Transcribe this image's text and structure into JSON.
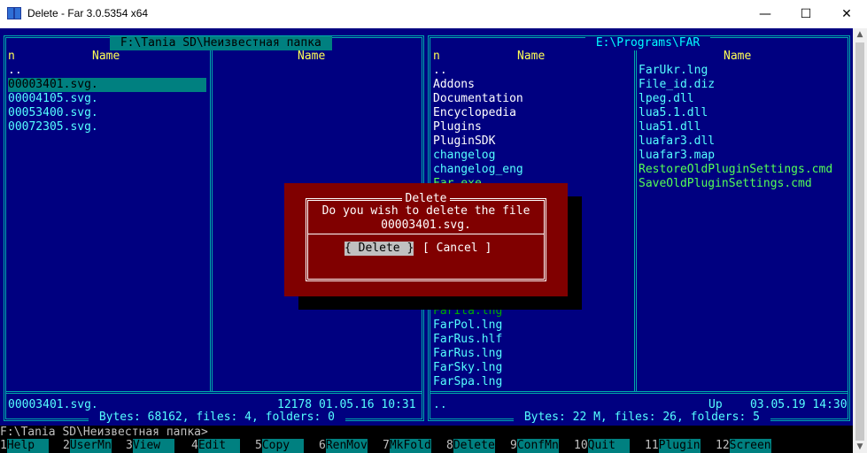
{
  "window": {
    "title": "Delete - Far 3.0.5354 x64",
    "minimize": "—",
    "maximize": "☐",
    "close": "✕"
  },
  "left_panel": {
    "path": " F:\\Tania SD\\Неизвестная папка ",
    "col1_header": "n",
    "col1_name": "Name",
    "col2_name": "Name",
    "files": [
      "..",
      "00003401.svg.",
      "00004105.svg.",
      "00053400.svg.",
      "00072305.svg."
    ],
    "info_name": "00003401.svg.",
    "info_details": "12178 01.05.16 10:31",
    "summary": " Bytes: 68162, files: 4, folders: 0 "
  },
  "right_panel": {
    "path": " E:\\Programs\\FAR ",
    "col1_header": "n",
    "col1_name": "Name",
    "col2_name": "Name",
    "col1_files": [
      "..",
      "Addons",
      "Documentation",
      "Encyclopedia",
      "Plugins",
      "PluginSDK",
      "changelog",
      "changelog_eng",
      "Far.exe"
    ],
    "col1_files_lower": [
      "FarIta.lng",
      "FarPol.lng",
      "FarRus.hlf",
      "FarRus.lng",
      "FarSky.lng",
      "FarSpa.lng"
    ],
    "col2_files": [
      "FarUkr.lng",
      "File_id.diz",
      "lpeg.dll",
      "lua5.1.dll",
      "lua51.dll",
      "luafar3.dll",
      "luafar3.map",
      "RestoreOldPluginSettings.cmd",
      "SaveOldPluginSettings.cmd"
    ],
    "info_name": "..",
    "info_details": "Up    03.05.19 14:30",
    "summary": " Bytes: 22 M, files: 26, folders: 5 "
  },
  "dialog": {
    "title": "Delete",
    "line1": "Do you wish to delete the file",
    "line2": "00003401.svg.",
    "delete_button": "{ Delete }",
    "cancel_button": "[ Cancel ]"
  },
  "command_line": "F:\\Tania SD\\Неизвестная папка>",
  "keybar": [
    {
      "num": "1",
      "label": "Help  "
    },
    {
      "num": "2",
      "label": "UserMn"
    },
    {
      "num": "3",
      "label": "View  "
    },
    {
      "num": "4",
      "label": "Edit  "
    },
    {
      "num": "5",
      "label": "Copy  "
    },
    {
      "num": "6",
      "label": "RenMov"
    },
    {
      "num": "7",
      "label": "MkFold"
    },
    {
      "num": "8",
      "label": "Delete"
    },
    {
      "num": "9",
      "label": "ConfMn"
    },
    {
      "num": "10",
      "label": "Quit  "
    },
    {
      "num": "11",
      "label": "Plugin"
    },
    {
      "num": "12",
      "label": "Screen"
    }
  ],
  "colors": {
    "panel_bg": "#000080",
    "frame": "#00aaaa",
    "dialog_bg": "#800000",
    "cursor": "#008080"
  }
}
